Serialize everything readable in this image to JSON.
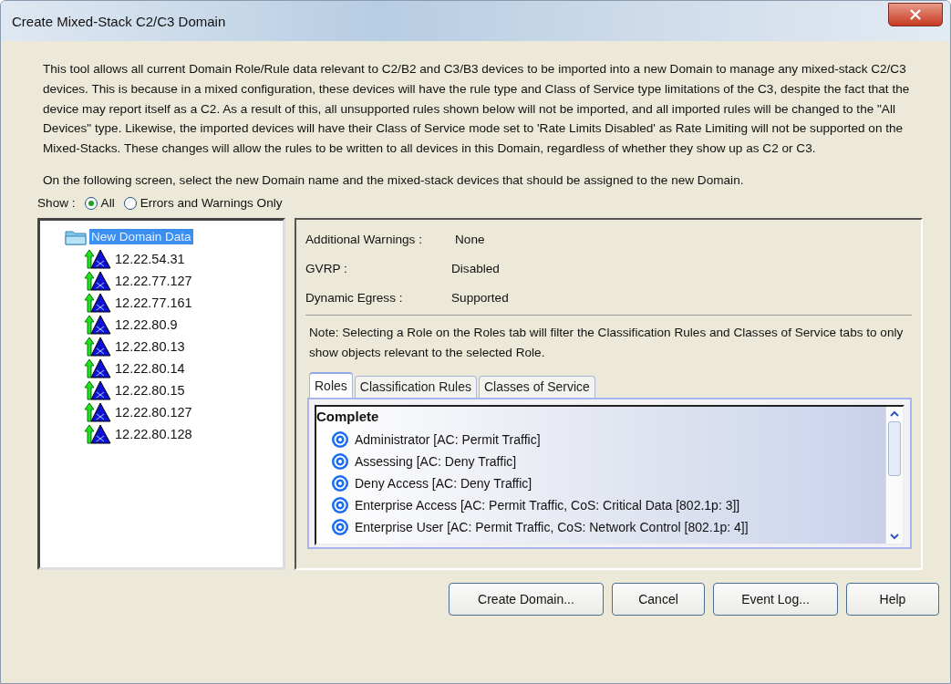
{
  "window": {
    "title": "Create Mixed-Stack C2/C3 Domain"
  },
  "description": "This tool allows all current Domain Role/Rule data relevant to C2/B2 and C3/B3 devices to be imported into a new Domain to manage any mixed-stack C2/C3 devices. This is because in a mixed configuration, these devices will have the rule type and Class of Service type limitations of the C3, despite the fact that the device may report itself as a C2. As a result of this, all unsupported rules shown below will not be imported, and all imported rules will be changed to the \"All Devices\" type. Likewise, the imported devices will have their Class of Service mode set to 'Rate Limits Disabled' as Rate Limiting will not be supported on the Mixed-Stacks.  These changes will allow the rules to be written to all devices in this Domain, regardless of whether they show up as C2 or C3.",
  "instruction": "On the following screen, select the new Domain name and the mixed-stack devices that should be assigned to the new Domain.",
  "show": {
    "label": "Show :",
    "options": [
      {
        "label": "All",
        "selected": true
      },
      {
        "label": "Errors and Warnings Only",
        "selected": false
      }
    ]
  },
  "tree": {
    "label": "New Domain Data",
    "selected": true,
    "children": [
      {
        "label": "12.22.54.31",
        "selected": false
      },
      {
        "label": "12.22.77.127",
        "selected": false
      },
      {
        "label": "12.22.77.161",
        "selected": false
      },
      {
        "label": "12.22.80.9",
        "selected": false
      },
      {
        "label": "12.22.80.13",
        "selected": false
      },
      {
        "label": "12.22.80.14",
        "selected": false
      },
      {
        "label": "12.22.80.15",
        "selected": false
      },
      {
        "label": "12.22.80.127",
        "selected": false
      },
      {
        "label": "12.22.80.128",
        "selected": false
      }
    ]
  },
  "details": [
    {
      "label": "Additional Warnings :",
      "value": "None"
    },
    {
      "label": "GVRP :",
      "value": "Disabled"
    },
    {
      "label": "Dynamic Egress :",
      "value": "Supported"
    }
  ],
  "note": "Note: Selecting a Role on the Roles tab will filter the Classification Rules and Classes of Service tabs to only show objects relevant to the selected Role.",
  "tabs": [
    {
      "label": "Roles",
      "selected": true
    },
    {
      "label": "Classification Rules",
      "selected": false
    },
    {
      "label": "Classes of Service",
      "selected": false
    }
  ],
  "roles": {
    "heading": "Complete",
    "items": [
      "Administrator [AC: Permit Traffic]",
      "Assessing [AC: Deny Traffic]",
      "Deny Access [AC: Deny Traffic]",
      "Enterprise Access [AC: Permit Traffic, CoS: Critical Data [802.1p: 3]]",
      "Enterprise User [AC: Permit Traffic, CoS: Network Control [802.1p: 4]]"
    ]
  },
  "buttons": [
    "Create Domain...",
    "Cancel",
    "Event Log...",
    "Help"
  ]
}
